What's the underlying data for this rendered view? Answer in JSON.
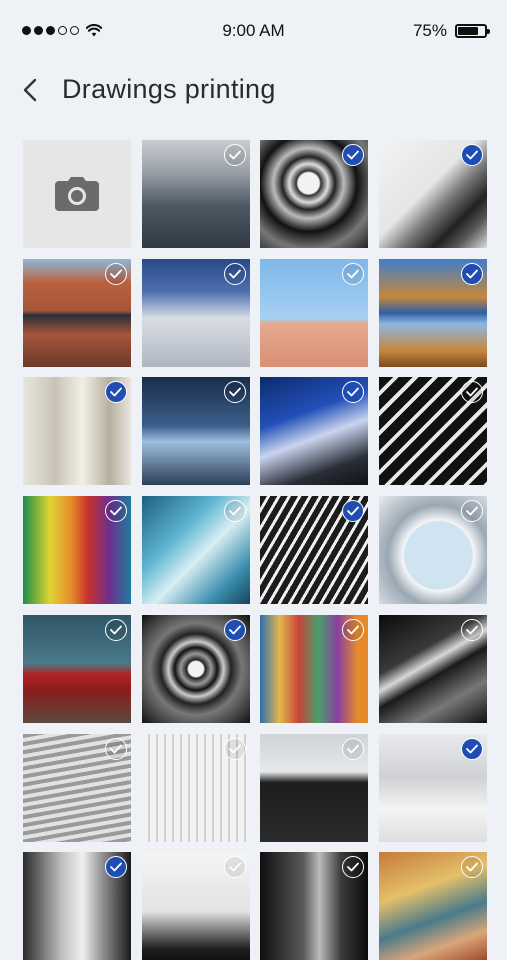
{
  "status_bar": {
    "time": "9:00 AM",
    "battery_percent": "75%",
    "battery_level": 0.75,
    "signal_bars_filled": 3,
    "signal_bars_total": 5
  },
  "header": {
    "back_icon": "chevron-left-icon",
    "title": "Drawings printing"
  },
  "grid": {
    "camera_icon": "camera-icon",
    "photos": [
      {
        "selected": false,
        "style": "skyscrapers"
      },
      {
        "selected": true,
        "style": "spiral-stairs"
      },
      {
        "selected": true,
        "style": "curved-facade"
      },
      {
        "selected": false,
        "style": "red-building-reflection"
      },
      {
        "selected": false,
        "style": "person-blue-walkway"
      },
      {
        "selected": false,
        "style": "pink-buildings-sky"
      },
      {
        "selected": true,
        "style": "mosque-reflection"
      },
      {
        "selected": true,
        "style": "white-arches"
      },
      {
        "selected": false,
        "style": "bridge-underside"
      },
      {
        "selected": true,
        "style": "blue-tunnel"
      },
      {
        "selected": false,
        "style": "black-white-ribs"
      },
      {
        "selected": false,
        "style": "rainbow-corridor"
      },
      {
        "selected": false,
        "style": "teal-curved-building"
      },
      {
        "selected": true,
        "style": "angled-grid-facade"
      },
      {
        "selected": false,
        "style": "round-opening-sky"
      },
      {
        "selected": false,
        "style": "red-sofa-room"
      },
      {
        "selected": true,
        "style": "spiral-staircase-bw"
      },
      {
        "selected": false,
        "style": "colorful-houses"
      },
      {
        "selected": false,
        "style": "dark-angular-structure"
      },
      {
        "selected": false,
        "style": "striped-grey-facade"
      },
      {
        "selected": false,
        "style": "white-ribbed-wall"
      },
      {
        "selected": false,
        "style": "black-pyramid-building"
      },
      {
        "selected": true,
        "style": "snow-trees-walker"
      },
      {
        "selected": true,
        "style": "white-tower"
      },
      {
        "selected": false,
        "style": "birds-silhouette"
      },
      {
        "selected": false,
        "style": "dark-waterfall"
      },
      {
        "selected": false,
        "style": "colorful-portrait"
      }
    ]
  }
}
